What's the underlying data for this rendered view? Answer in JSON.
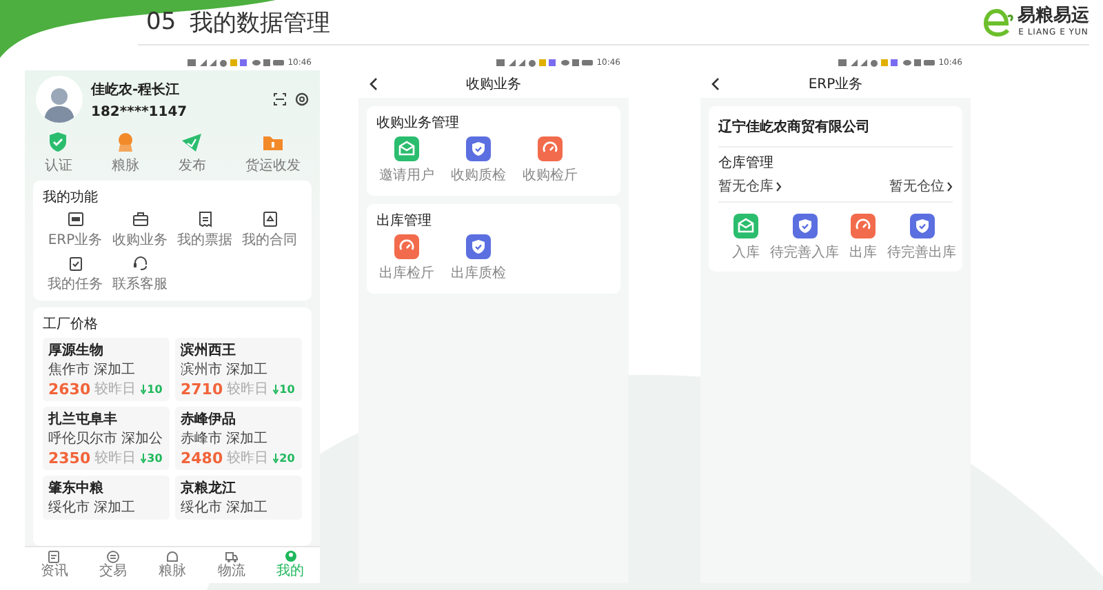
{
  "header": {
    "number": "05",
    "title": "我的数据管理"
  },
  "logo": {
    "name": "易粮易运",
    "subtitle": "E LIANG E YUN"
  },
  "profile_screen": {
    "status_time": "10:46",
    "user": {
      "name": "佳屹农-程长江",
      "phone": "182****1147"
    },
    "shortcuts": [
      {
        "label": "认证",
        "kind": "shield"
      },
      {
        "label": "粮脉",
        "kind": "badge"
      },
      {
        "label": "发布",
        "kind": "plane"
      },
      {
        "label": "货运收发",
        "kind": "folder"
      }
    ],
    "functions": {
      "title": "我的功能",
      "items": [
        {
          "label": "ERP业务",
          "kind": "erp"
        },
        {
          "label": "收购业务",
          "kind": "briefcase"
        },
        {
          "label": "我的票据",
          "kind": "receipt"
        },
        {
          "label": "我的合同",
          "kind": "contract"
        },
        {
          "label": "我的任务",
          "kind": "clipboard"
        },
        {
          "label": "联系客服",
          "kind": "headset"
        }
      ]
    },
    "factory_prices": {
      "title": "工厂价格",
      "items": [
        {
          "name": "厚源生物",
          "city": "焦作市",
          "type": "深加工",
          "price": "2630",
          "change_label": "较昨日",
          "change": "10"
        },
        {
          "name": "滨州西王",
          "city": "滨州市",
          "type": "深加工",
          "price": "2710",
          "change_label": "较昨日",
          "change": "10"
        },
        {
          "name": "扎兰屯阜丰",
          "city": "呼伦贝尔市",
          "type": "深加公",
          "price": "2350",
          "change_label": "较昨日",
          "change": "30"
        },
        {
          "name": "赤峰伊品",
          "city": "赤峰市",
          "type": "深加工",
          "price": "2480",
          "change_label": "较昨日",
          "change": "20"
        },
        {
          "name": "肇东中粮",
          "city": "绥化市",
          "type": "深加工"
        },
        {
          "name": "京粮龙江",
          "city": "绥化市",
          "type": "深加工"
        }
      ]
    },
    "nav": [
      {
        "label": "资讯",
        "kind": "news",
        "selected": false
      },
      {
        "label": "交易",
        "kind": "trade",
        "selected": false
      },
      {
        "label": "粮脉",
        "kind": "grain",
        "selected": false
      },
      {
        "label": "物流",
        "kind": "truck",
        "selected": false
      },
      {
        "label": "我的",
        "kind": "user",
        "selected": true
      }
    ]
  },
  "purchase_screen": {
    "status_time": "10:46",
    "title": "收购业务",
    "sections": [
      {
        "title": "收购业务管理",
        "tiles": [
          {
            "label": "邀请用户",
            "kind": "envelope",
            "color": "#2bbd6e"
          },
          {
            "label": "收购质检",
            "kind": "shield",
            "color": "#5b6fe0"
          },
          {
            "label": "收购检斤",
            "kind": "gauge",
            "color": "#f26b4c"
          }
        ]
      },
      {
        "title": "出库管理",
        "tiles": [
          {
            "label": "出库检斤",
            "kind": "gauge",
            "color": "#f26b4c"
          },
          {
            "label": "出库质检",
            "kind": "shield",
            "color": "#5b6fe0"
          }
        ]
      }
    ]
  },
  "erp_screen": {
    "status_time": "10:46",
    "title": "ERP业务",
    "company": "辽宁佳屹农商贸有限公司",
    "warehouse_title": "仓库管理",
    "warehouse_link": "暂无仓库",
    "location_link": "暂无仓位",
    "tiles": [
      {
        "label": "入库",
        "kind": "envelope",
        "color": "#2bbd6e"
      },
      {
        "label": "待完善入库",
        "kind": "shield",
        "color": "#5b6fe0"
      },
      {
        "label": "出库",
        "kind": "gauge",
        "color": "#f26b4c"
      },
      {
        "label": "待完善出库",
        "kind": "shield",
        "color": "#5b6fe0"
      }
    ]
  }
}
